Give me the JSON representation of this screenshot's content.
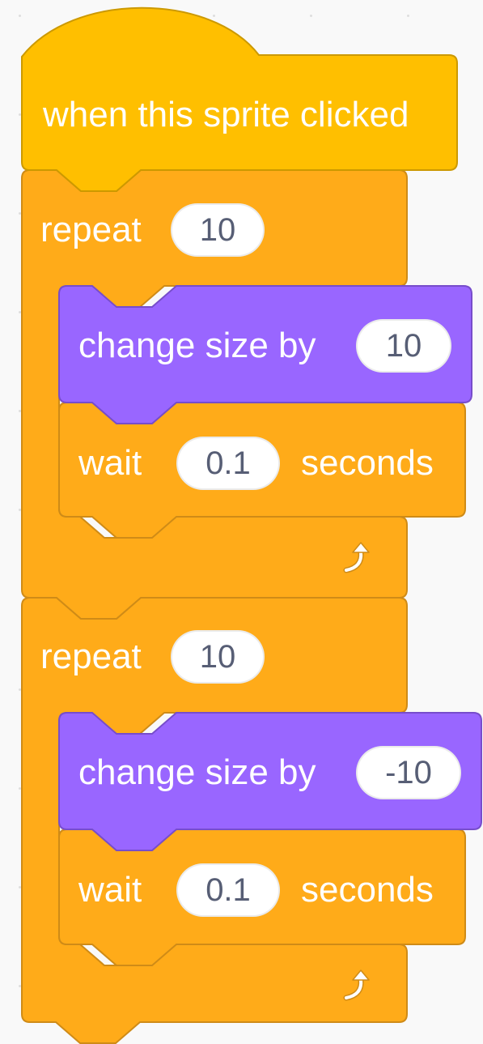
{
  "colors": {
    "background": "#f9f9f9",
    "events": "#ffbf00",
    "control": "#ffab19",
    "looks": "#9966ff",
    "input_text": "#575e75",
    "label_text": "#ffffff"
  },
  "script": {
    "hat": {
      "label": "when this sprite clicked"
    },
    "loops": [
      {
        "label": "repeat",
        "count": "10",
        "loop_icon": "loop-arrow-icon",
        "body": {
          "change_size": {
            "label": "change size by",
            "value": "10"
          },
          "wait": {
            "label": "wait",
            "value": "0.1",
            "unit": "seconds"
          }
        }
      },
      {
        "label": "repeat",
        "count": "10",
        "loop_icon": "loop-arrow-icon",
        "body": {
          "change_size": {
            "label": "change size by",
            "value": "-10"
          },
          "wait": {
            "label": "wait",
            "value": "0.1",
            "unit": "seconds"
          }
        }
      }
    ]
  }
}
